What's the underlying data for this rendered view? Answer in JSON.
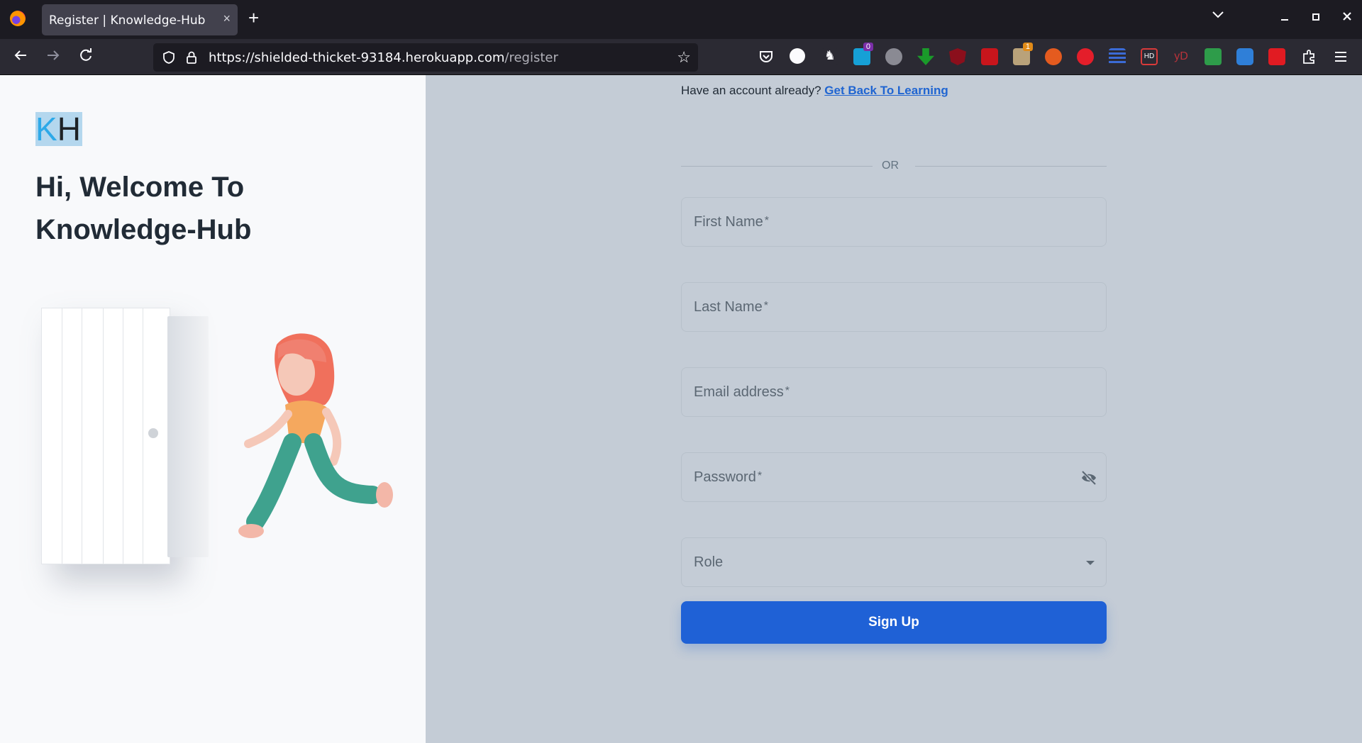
{
  "browser": {
    "tab_title": "Register | Knowledge-Hub",
    "tab_close": "×",
    "new_tab": "+",
    "url_main": "https://shielded-thicket-93184.herokuapp.com",
    "url_path": "/register",
    "extension_badges": {
      "badge_a": "0",
      "badge_b": "1"
    },
    "extension_label_hd": "HD",
    "extension_label_yd": "yD"
  },
  "brand": {
    "logo_k": "K",
    "logo_h": "H"
  },
  "welcome": {
    "line1": "Hi, Welcome To",
    "line2": "Knowledge-Hub"
  },
  "form": {
    "have_account_text": "Have an account already?",
    "back_link": "Get Back To Learning",
    "divider_text": "OR",
    "first_name_label": "First Name",
    "last_name_label": "Last Name",
    "email_label": "Email address",
    "password_label": "Password",
    "required_mark": "*",
    "role_label": "Role",
    "submit_label": "Sign Up"
  },
  "icons": {
    "password_visibility": "eye-off-icon",
    "role_dropdown": "caret-down-icon",
    "brand_color": "#1f61d6"
  }
}
